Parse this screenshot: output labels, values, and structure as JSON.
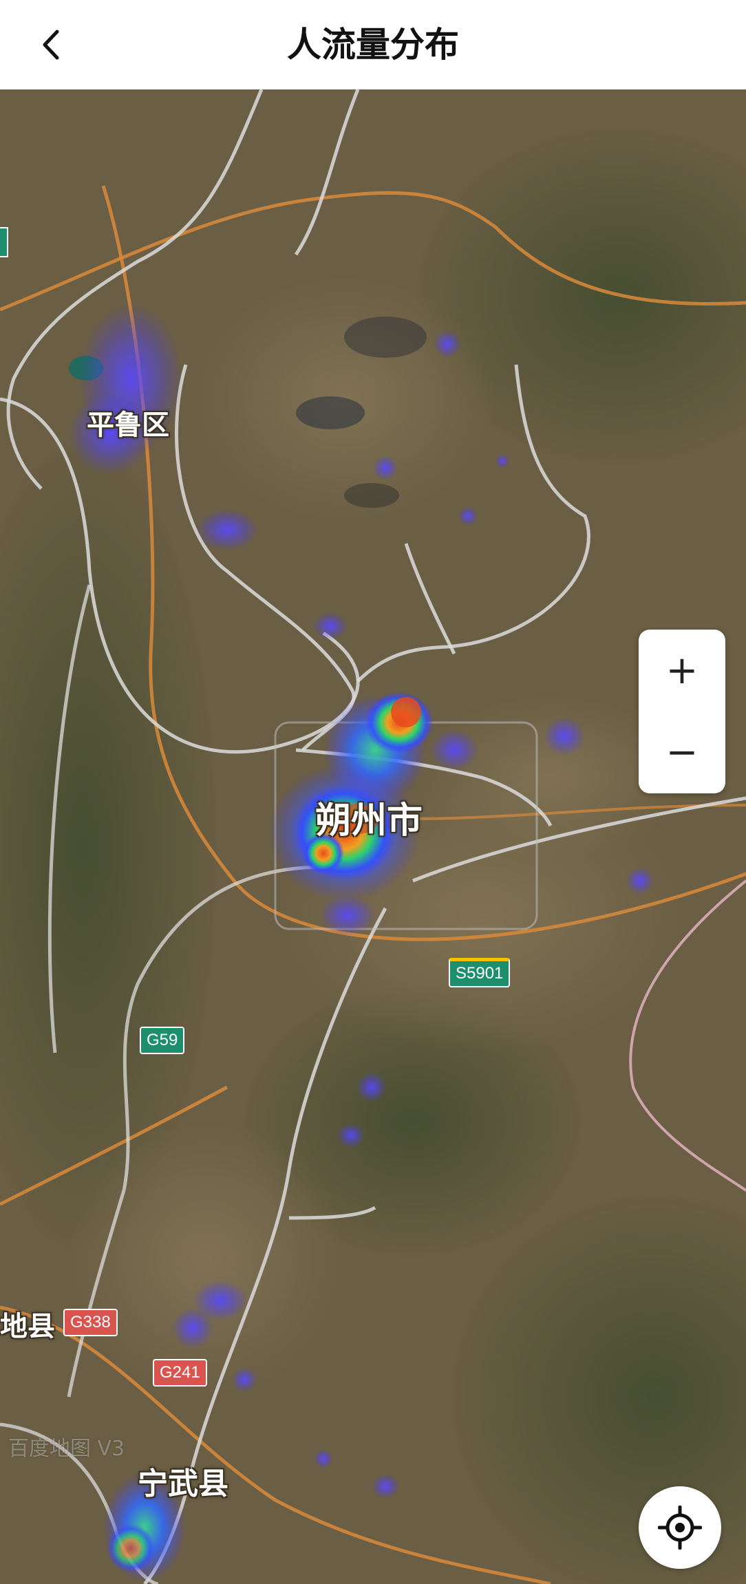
{
  "header": {
    "title": "人流量分布",
    "back_icon": "chevron-left-icon"
  },
  "map": {
    "places": [
      {
        "id": "pinglu",
        "name": "平鲁区"
      },
      {
        "id": "shuozhou",
        "name": "朔州市"
      },
      {
        "id": "shanyin",
        "name": "山阴县",
        "visible_text": "地县"
      },
      {
        "id": "ningwu",
        "name": "宁武县"
      }
    ],
    "road_shields": {
      "s5901": "S5901",
      "g59": "G59",
      "g338": "G338",
      "g241": "G241"
    },
    "watermark": "百度地图 V3"
  },
  "controls": {
    "zoom_in": "+",
    "zoom_out": "−",
    "locate_icon": "locate-crosshair-icon"
  },
  "colors": {
    "heat_low": "#4a3cff",
    "heat_mid": "#2bd46a",
    "heat_high": "#e84a1c",
    "highway": "#d98a3a",
    "road": "#e6e6e6"
  }
}
